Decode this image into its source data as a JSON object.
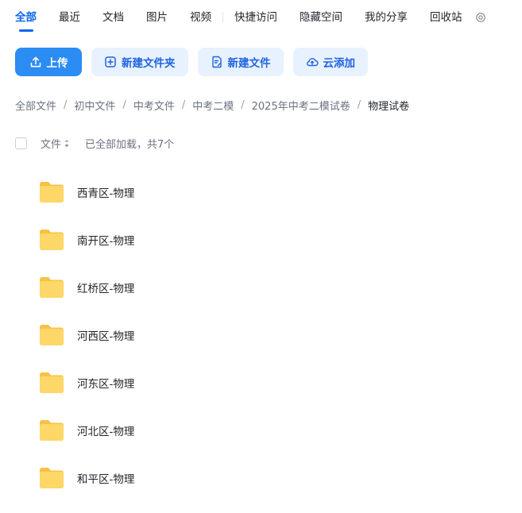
{
  "tabs": [
    "全部",
    "最近",
    "文档",
    "图片",
    "视频",
    "快捷访问",
    "隐藏空间",
    "我的分享",
    "回收站"
  ],
  "active_tab": 0,
  "toolbar": {
    "upload": "上传",
    "new_folder": "新建文件夹",
    "new_file": "新建文件",
    "cloud_add": "云添加"
  },
  "breadcrumb": [
    "全部文件",
    "初中文件",
    "中考文件",
    "中考二模",
    "2025年中考二模试卷",
    "物理试卷"
  ],
  "breadcrumb_separator": "/",
  "list_header": {
    "column": "文件",
    "status": "已全部加载，共7个"
  },
  "files": [
    {
      "name": "西青区-物理",
      "icon": "folder-icon"
    },
    {
      "name": "南开区-物理",
      "icon": "folder-icon"
    },
    {
      "name": "红桥区-物理",
      "icon": "folder-icon"
    },
    {
      "name": "河西区-物理",
      "icon": "folder-icon"
    },
    {
      "name": "河东区-物理",
      "icon": "folder-icon"
    },
    {
      "name": "河北区-物理",
      "icon": "folder-icon"
    },
    {
      "name": "和平区-物理",
      "icon": "folder-icon"
    }
  ],
  "colors": {
    "accent": "#0d64f0",
    "primary_button": "#2b8cf3",
    "secondary_button": "#e8f2fe",
    "folder": "#fcd666"
  }
}
